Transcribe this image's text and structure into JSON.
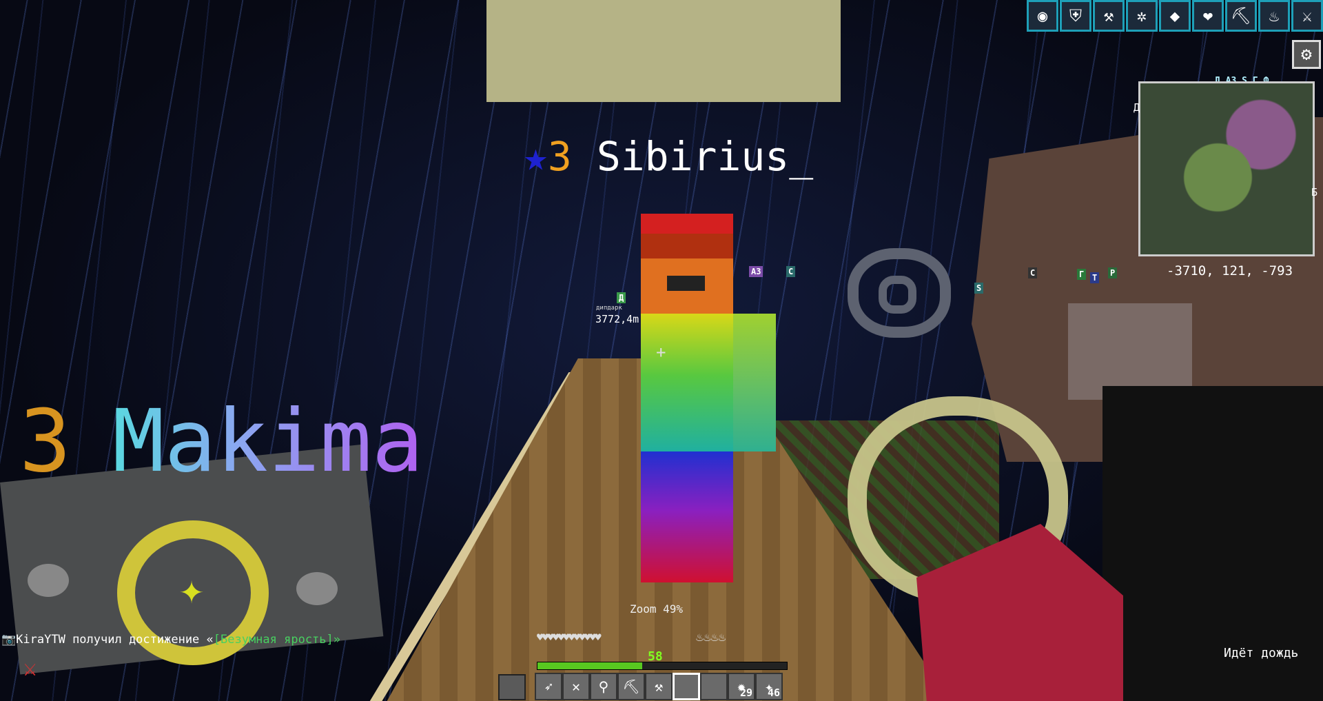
{
  "players": {
    "sibirius": {
      "level_icon": "★",
      "level": "3",
      "name": "Sibirius_"
    },
    "makima": {
      "level": "3",
      "name": "Makima"
    }
  },
  "waypoints": {
    "d": "Д",
    "d_name": "дипдарк",
    "d_distance": "3772,4m",
    "a3": "А3",
    "s1": "С",
    "s2": "S",
    "s3": "С",
    "g": "Г",
    "t": "Т",
    "r": "Р"
  },
  "crosshair": "+",
  "zoom": "Zoom 49%",
  "effects": [
    {
      "icon": "orb-icon",
      "glyph": "◉"
    },
    {
      "icon": "shield-icon",
      "glyph": "⛨"
    },
    {
      "icon": "boots-icon",
      "glyph": "⚒"
    },
    {
      "icon": "clover-icon",
      "glyph": "✲"
    },
    {
      "icon": "wolf-icon",
      "glyph": "◆"
    },
    {
      "icon": "heart-icon",
      "glyph": "❤"
    },
    {
      "icon": "pickaxe-icon",
      "glyph": "⛏"
    },
    {
      "icon": "fire-resist-icon",
      "glyph": "♨"
    },
    {
      "icon": "sword-icon",
      "glyph": "⚔"
    }
  ],
  "minimap": {
    "top_markers": "Д А3 S Г Ф",
    "north": "Д",
    "east": "Б",
    "coords": "-3710, 121, -793"
  },
  "chat": {
    "prefix": "📷",
    "player": "KiraYTW",
    "text": " получил достижение «",
    "advancement": "[Безумная ярость]",
    "end": "»"
  },
  "weather": "Идёт дождь",
  "hud": {
    "armor": "♥♥♥♥♥♥♥♥♥♥♥♥",
    "hunger": "♨♨♨♨",
    "xp_level": "58",
    "xp_progress": 0.42,
    "hotbar": [
      {
        "icon": "bow-icon",
        "glyph": "➶",
        "count": ""
      },
      {
        "icon": "crossbow-icon",
        "glyph": "✕",
        "count": ""
      },
      {
        "icon": "trident-icon",
        "glyph": "⚲",
        "count": ""
      },
      {
        "icon": "pickaxe-icon",
        "glyph": "⛏",
        "count": ""
      },
      {
        "icon": "axe-icon",
        "glyph": "⚒",
        "count": ""
      },
      {
        "icon": "empty-slot",
        "glyph": "",
        "count": ""
      },
      {
        "icon": "empty-slot",
        "glyph": "",
        "count": ""
      },
      {
        "icon": "firework-icon",
        "glyph": "✹",
        "count": "29"
      },
      {
        "icon": "torch-icon",
        "glyph": "✦",
        "count": "46"
      }
    ],
    "selected_slot": 6
  },
  "colors": {
    "sky": "#0b0d1f",
    "xp": "#58c820",
    "chat_advancement": "#48d060",
    "effect_border": "#1ea0b8"
  }
}
